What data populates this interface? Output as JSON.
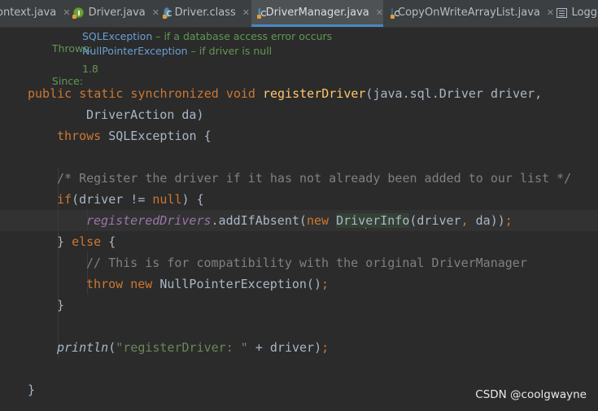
{
  "tabs": [
    {
      "label": "ontext.java",
      "icon": "none"
    },
    {
      "label": "Driver.java",
      "icon": "interface-icon"
    },
    {
      "label": "Driver.class",
      "icon": "class-icon"
    },
    {
      "label": "DriverManager.java",
      "icon": "class-icon",
      "active": true
    },
    {
      "label": "CopyOnWriteArrayList.java",
      "icon": "class-icon"
    },
    {
      "label": "Logge",
      "icon": "structure-icon"
    }
  ],
  "close_glyph": "✕",
  "javadoc": {
    "throws_label": "Throws:",
    "throws": [
      {
        "type": "SQLException",
        "desc": " – if a database access error occurs"
      },
      {
        "type": "NullPointerException",
        "desc": " – if driver is null"
      }
    ],
    "since_label": "Since:",
    "since_value": "1.8"
  },
  "code": {
    "l1_mods": "public static synchronized void ",
    "l1_name": "registerDriver",
    "l1_rest": "(java.sql.Driver driver,",
    "l2": "DriverAction da)",
    "l3_kw": "throws",
    "l3_rest": " SQLException {",
    "l4": "/* Register the driver if it has not already been added to our list */",
    "l5_kw1": "if",
    "l5_mid": "(driver != ",
    "l5_kw2": "null",
    "l5_end": ") {",
    "l6_field": "registeredDrivers",
    "l6_call": ".addIfAbsent(",
    "l6_new": "new ",
    "l6_cls_a": "Driv",
    "l6_cls_b": "erInfo",
    "l6_args": "(driver",
    "l6_comma": ", ",
    "l6_tail": "da))",
    "l6_semi": ";",
    "l7_brace": "} ",
    "l7_kw": "else",
    "l7_end": " {",
    "l8": "// This is for compatibility with the original DriverManager",
    "l9_kw1": "throw ",
    "l9_kw2": "new ",
    "l9_rest": "NullPointerException()",
    "l9_semi": ";",
    "l10": "}",
    "l11_fn": "println",
    "l11_open": "(",
    "l11_str": "\"registerDriver: \"",
    "l11_rest": " + driver)",
    "l11_semi": ";",
    "l12": "}"
  },
  "watermark": "CSDN @coolgwayne"
}
